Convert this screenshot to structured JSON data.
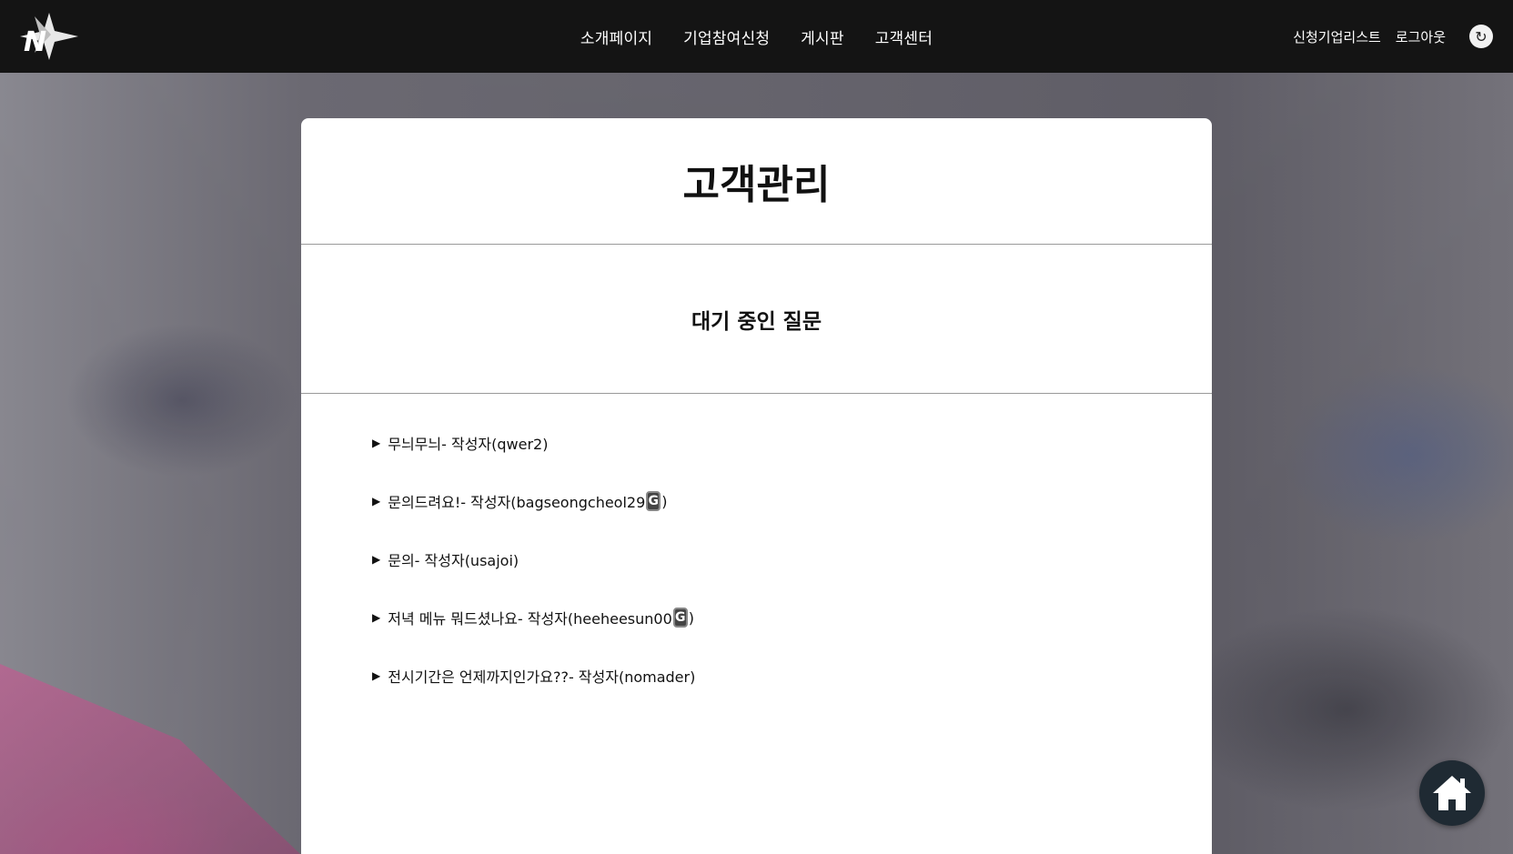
{
  "header": {
    "logo_text": "N",
    "nav": [
      {
        "label": "소개페이지"
      },
      {
        "label": "기업참여신청"
      },
      {
        "label": "게시판"
      },
      {
        "label": "고객센터"
      }
    ],
    "right_links": [
      {
        "label": "신청기업리스트"
      },
      {
        "label": "로그아웃"
      }
    ],
    "refresh_icon": "↻"
  },
  "main": {
    "title": "고객관리",
    "section_title": "대기 중인 질문",
    "questions": [
      {
        "marker": "▶",
        "text_before": "무늬무늬- 작성자(qwer2)",
        "badge": "",
        "text_after": ""
      },
      {
        "marker": "▶",
        "text_before": "문의드려요!- 작성자(bagseongcheol29",
        "badge": "G",
        "text_after": ")"
      },
      {
        "marker": "▶",
        "text_before": "문의- 작성자(usajoi)",
        "badge": "",
        "text_after": ""
      },
      {
        "marker": "▶",
        "text_before": "저녁 메뉴 뭐드셨나요- 작성자(heeheesun00",
        "badge": "G",
        "text_after": ")"
      },
      {
        "marker": "▶",
        "text_before": "전시기간은 언제까지인가요??- 작성자(nomader)",
        "badge": "",
        "text_after": ""
      }
    ]
  },
  "home_button": {
    "icon": "home-icon"
  }
}
